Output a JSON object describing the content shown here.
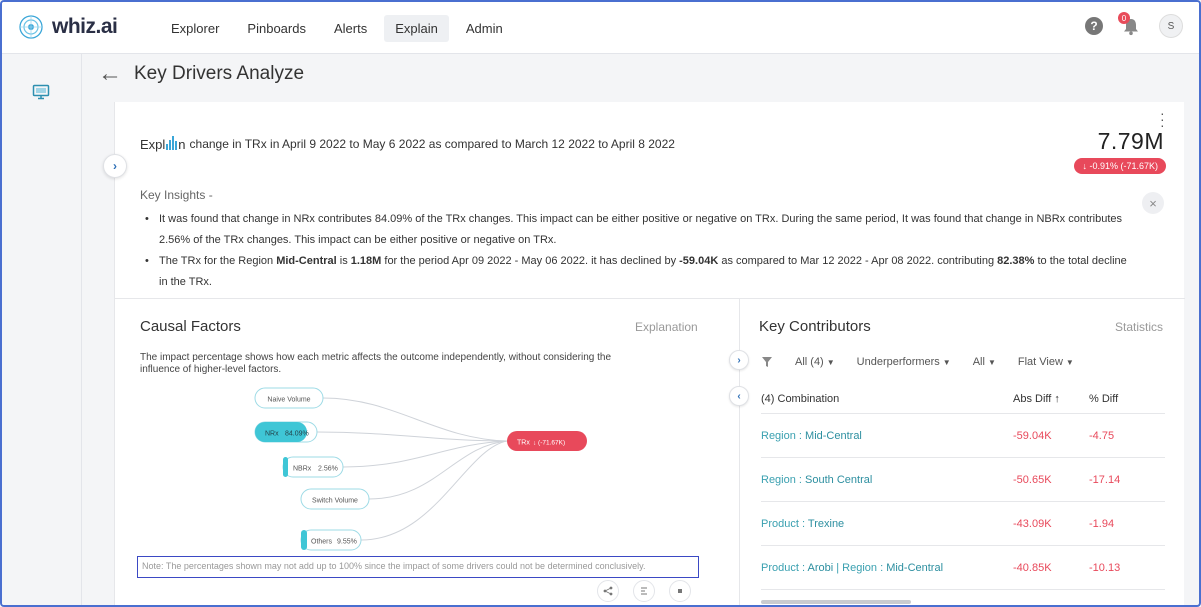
{
  "app": {
    "logo_text": "whiz.ai"
  },
  "nav": {
    "items": [
      "Explorer",
      "Pinboards",
      "Alerts",
      "Explain",
      "Admin"
    ],
    "active": "Explain",
    "notification_count": "0",
    "user_initial": "S"
  },
  "page": {
    "title": "Key Drivers Analyze"
  },
  "explain": {
    "logo_prefix": "Expl",
    "logo_suffix": "n",
    "description": "change in TRx in April 9 2022 to May 6 2022 as compared to March 12 2022 to April 8 2022",
    "metric_value": "7.79M",
    "metric_delta": "↓ -0.91% (-71.67K)"
  },
  "insights": {
    "label": "Key Insights -",
    "bullet1": "It was found that change in NRx contributes 84.09% of the TRx changes. This impact can be either positive or negative on TRx. During the same period, It was found that change in NBRx contributes 2.56% of the TRx changes. This impact can be either positive or negative on TRx.",
    "bullet2_parts": {
      "a": "The TRx for the Region ",
      "region": "Mid-Central",
      "b": " is ",
      "value": "1.18M",
      "c": " for the period Apr 09 2022 - May 06 2022. it has declined by ",
      "decline": "-59.04K",
      "d": " as compared to Mar 12 2022 - Apr 08 2022. contributing ",
      "pct": "82.38%",
      "e": " to the total decline in the TRx."
    }
  },
  "causal": {
    "title": "Causal Factors",
    "explanation_link": "Explanation",
    "description": "The impact percentage shows how each metric affects the outcome independently, without considering the influence of higher-level factors.",
    "nodes": [
      {
        "label": "Naive Volume",
        "pct": "",
        "fill": 0
      },
      {
        "label": "NRx",
        "pct": "84.09%",
        "fill": 0.84
      },
      {
        "label": "NBRx",
        "pct": "2.56%",
        "fill": 0.03
      },
      {
        "label": "Switch Volume",
        "pct": "",
        "fill": 0
      },
      {
        "label": "Others",
        "pct": "9.55%",
        "fill": 0.1
      }
    ],
    "target": {
      "label": "TRx",
      "delta": "↓ (-71.67K)"
    },
    "note": "Note: The percentages shown may not add up to 100% since the impact of some drivers could not be determined conclusively."
  },
  "contributors": {
    "title": "Key Contributors",
    "statistics_link": "Statistics",
    "filters": [
      "All (4)",
      "Underperformers",
      "All",
      "Flat View"
    ],
    "columns": [
      "(4) Combination",
      "Abs Diff",
      "% Diff"
    ],
    "rows": [
      {
        "k1": "Region",
        "v1": "Mid-Central",
        "k2": "",
        "v2": "",
        "abs": "-59.04K",
        "pct": "-4.75"
      },
      {
        "k1": "Region",
        "v1": "South Central",
        "k2": "",
        "v2": "",
        "abs": "-50.65K",
        "pct": "-17.14"
      },
      {
        "k1": "Product",
        "v1": "Trexine",
        "k2": "",
        "v2": "",
        "abs": "-43.09K",
        "pct": "-1.94"
      },
      {
        "k1": "Product",
        "v1": "Arobi",
        "k2": "Region",
        "v2": "Mid-Central",
        "abs": "-40.85K",
        "pct": "-10.13"
      }
    ]
  },
  "colors": {
    "accent": "#3aa0b0",
    "negative": "#e8495b",
    "nav_active_bg": "#eef0f3",
    "node_fill": "#3fc6d6"
  }
}
